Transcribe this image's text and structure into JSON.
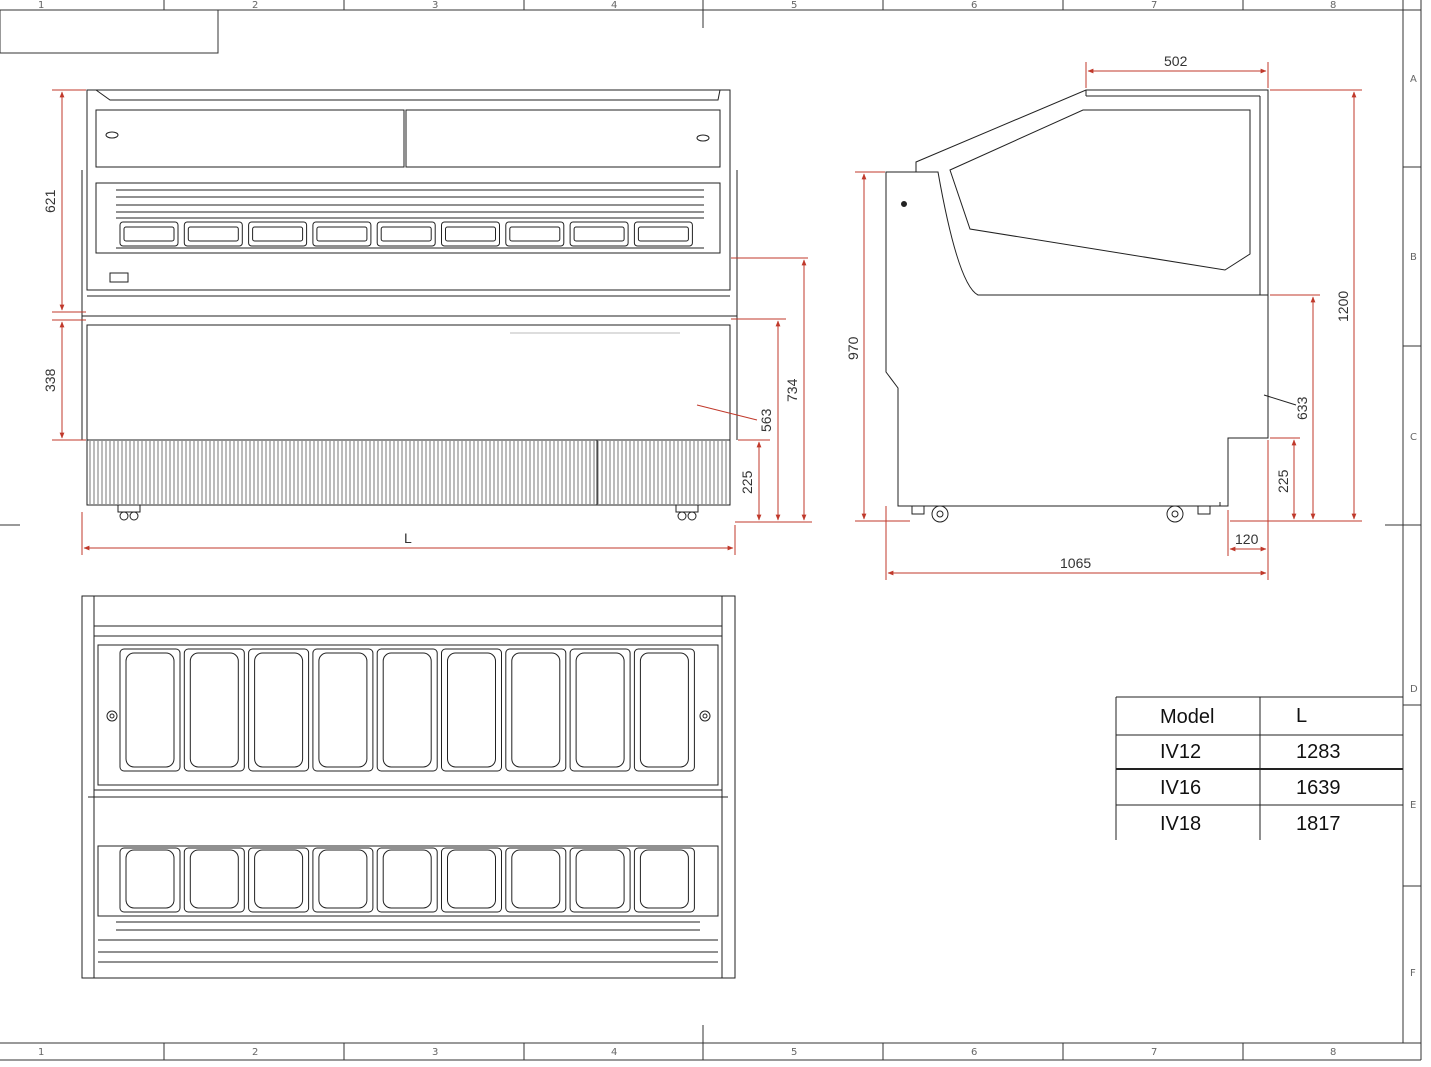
{
  "sheet": {
    "grid_columns": [
      "1",
      "2",
      "3",
      "4",
      "5",
      "6",
      "7",
      "8"
    ],
    "grid_rows": [
      "A",
      "B",
      "C",
      "D",
      "E",
      "F"
    ]
  },
  "front_view": {
    "dims": {
      "top_height": "621",
      "lower_height": "338",
      "base_height": "225",
      "mid_height": "563",
      "total_height": "734",
      "length": "L"
    }
  },
  "side_view": {
    "dims": {
      "top_depth": "502",
      "total_height": "1200",
      "body_height": "970",
      "lower_height": "633",
      "base_height": "225",
      "base_depth": "120",
      "depth": "1065"
    }
  },
  "model_table": {
    "headers": [
      "Model",
      "L"
    ],
    "rows": [
      [
        "IV12",
        "1283"
      ],
      [
        "IV16",
        "1639"
      ],
      [
        "IV18",
        "1817"
      ]
    ]
  },
  "colors": {
    "dimension": "#c0392b",
    "outline": "#222222"
  }
}
